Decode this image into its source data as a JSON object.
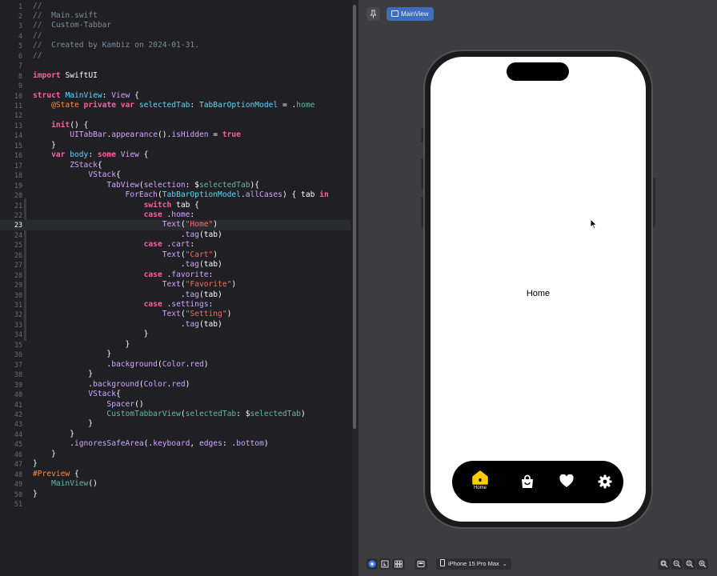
{
  "editor": {
    "current_line": 23,
    "lines": [
      {
        "n": "1",
        "segs": [
          [
            "cm",
            "//"
          ]
        ]
      },
      {
        "n": "2",
        "segs": [
          [
            "cm",
            "//  "
          ],
          [
            "cmt",
            "Main.swift"
          ]
        ]
      },
      {
        "n": "3",
        "segs": [
          [
            "cm",
            "//  "
          ],
          [
            "cmt",
            "Custom-Tabbar"
          ]
        ]
      },
      {
        "n": "4",
        "segs": [
          [
            "cm",
            "//"
          ]
        ]
      },
      {
        "n": "5",
        "segs": [
          [
            "cm",
            "//  "
          ],
          [
            "cmt",
            "Created by Kambiz on 2024-01-31."
          ]
        ]
      },
      {
        "n": "6",
        "segs": [
          [
            "cm",
            "//"
          ]
        ]
      },
      {
        "n": "7",
        "segs": []
      },
      {
        "n": "8",
        "segs": [
          [
            "kw",
            "import "
          ],
          [
            "plain",
            "SwiftUI"
          ]
        ]
      },
      {
        "n": "9",
        "segs": []
      },
      {
        "n": "10",
        "segs": [
          [
            "kw",
            "struct "
          ],
          [
            "ty",
            "MainView"
          ],
          [
            "plain",
            ": "
          ],
          [
            "pj",
            "View"
          ],
          [
            "plain",
            " {"
          ]
        ]
      },
      {
        "n": "11",
        "segs": [
          [
            "plain",
            "    "
          ],
          [
            "at",
            "@State"
          ],
          [
            "plain",
            " "
          ],
          [
            "kw",
            "private var "
          ],
          [
            "ty",
            "selectedTab"
          ],
          [
            "plain",
            ": "
          ],
          [
            "ty",
            "TabBarOptionModel"
          ],
          [
            "plain",
            " = ."
          ],
          [
            "fn",
            "home"
          ]
        ]
      },
      {
        "n": "12",
        "segs": []
      },
      {
        "n": "13",
        "segs": [
          [
            "plain",
            "    "
          ],
          [
            "kw",
            "init"
          ],
          [
            "plain",
            "() {"
          ]
        ]
      },
      {
        "n": "14",
        "segs": [
          [
            "plain",
            "        "
          ],
          [
            "pj",
            "UITabBar"
          ],
          [
            "plain",
            "."
          ],
          [
            "pj",
            "appearance"
          ],
          [
            "plain",
            "()."
          ],
          [
            "pj",
            "isHidden"
          ],
          [
            "plain",
            " = "
          ],
          [
            "kw",
            "true"
          ]
        ]
      },
      {
        "n": "15",
        "segs": [
          [
            "plain",
            "    }"
          ]
        ]
      },
      {
        "n": "16",
        "segs": [
          [
            "plain",
            "    "
          ],
          [
            "kw",
            "var "
          ],
          [
            "ty",
            "body"
          ],
          [
            "plain",
            ": "
          ],
          [
            "kw",
            "some "
          ],
          [
            "pj",
            "View"
          ],
          [
            "plain",
            " {"
          ]
        ]
      },
      {
        "n": "17",
        "segs": [
          [
            "plain",
            "        "
          ],
          [
            "pj",
            "ZStack"
          ],
          [
            "plain",
            "{"
          ]
        ]
      },
      {
        "n": "18",
        "segs": [
          [
            "plain",
            "            "
          ],
          [
            "pj",
            "VStack"
          ],
          [
            "plain",
            "{"
          ]
        ]
      },
      {
        "n": "19",
        "segs": [
          [
            "plain",
            "                "
          ],
          [
            "pj",
            "TabView"
          ],
          [
            "plain",
            "("
          ],
          [
            "pj",
            "selection"
          ],
          [
            "plain",
            ": $"
          ],
          [
            "fn",
            "selectedTab"
          ],
          [
            "plain",
            "){"
          ]
        ]
      },
      {
        "n": "20",
        "segs": [
          [
            "plain",
            "                    "
          ],
          [
            "pj",
            "ForEach"
          ],
          [
            "plain",
            "("
          ],
          [
            "ty",
            "TabBarOptionModel"
          ],
          [
            "plain",
            "."
          ],
          [
            "pj",
            "allCases"
          ],
          [
            "plain",
            ") { tab "
          ],
          [
            "kw",
            "in"
          ]
        ]
      },
      {
        "n": "21",
        "segs": [
          [
            "plain",
            "                        "
          ],
          [
            "kw",
            "switch"
          ],
          [
            "plain",
            " tab {"
          ]
        ]
      },
      {
        "n": "22",
        "segs": [
          [
            "plain",
            "                        "
          ],
          [
            "kw",
            "case"
          ],
          [
            "plain",
            " ."
          ],
          [
            "pj",
            "home"
          ],
          [
            "plain",
            ":"
          ]
        ]
      },
      {
        "n": "23",
        "segs": [
          [
            "plain",
            "                            "
          ],
          [
            "pj",
            "Text"
          ],
          [
            "plain",
            "("
          ],
          [
            "st",
            "\"Home\""
          ],
          [
            "plain",
            ")"
          ]
        ]
      },
      {
        "n": "24",
        "segs": [
          [
            "plain",
            "                                ."
          ],
          [
            "pj",
            "tag"
          ],
          [
            "plain",
            "(tab)"
          ]
        ]
      },
      {
        "n": "25",
        "segs": [
          [
            "plain",
            "                        "
          ],
          [
            "kw",
            "case"
          ],
          [
            "plain",
            " ."
          ],
          [
            "pj",
            "cart"
          ],
          [
            "plain",
            ":"
          ]
        ]
      },
      {
        "n": "26",
        "segs": [
          [
            "plain",
            "                            "
          ],
          [
            "pj",
            "Text"
          ],
          [
            "plain",
            "("
          ],
          [
            "st",
            "\"Cart\""
          ],
          [
            "plain",
            ")"
          ]
        ]
      },
      {
        "n": "27",
        "segs": [
          [
            "plain",
            "                                ."
          ],
          [
            "pj",
            "tag"
          ],
          [
            "plain",
            "(tab)"
          ]
        ]
      },
      {
        "n": "28",
        "segs": [
          [
            "plain",
            "                        "
          ],
          [
            "kw",
            "case"
          ],
          [
            "plain",
            " ."
          ],
          [
            "pj",
            "favorite"
          ],
          [
            "plain",
            ":"
          ]
        ]
      },
      {
        "n": "29",
        "segs": [
          [
            "plain",
            "                            "
          ],
          [
            "pj",
            "Text"
          ],
          [
            "plain",
            "("
          ],
          [
            "st",
            "\"Favorite\""
          ],
          [
            "plain",
            ")"
          ]
        ]
      },
      {
        "n": "30",
        "segs": [
          [
            "plain",
            "                                ."
          ],
          [
            "pj",
            "tag"
          ],
          [
            "plain",
            "(tab)"
          ]
        ]
      },
      {
        "n": "31",
        "segs": [
          [
            "plain",
            "                        "
          ],
          [
            "kw",
            "case"
          ],
          [
            "plain",
            " ."
          ],
          [
            "pj",
            "settings"
          ],
          [
            "plain",
            ":"
          ]
        ]
      },
      {
        "n": "32",
        "segs": [
          [
            "plain",
            "                            "
          ],
          [
            "pj",
            "Text"
          ],
          [
            "plain",
            "("
          ],
          [
            "st",
            "\"Setting\""
          ],
          [
            "plain",
            ")"
          ]
        ]
      },
      {
        "n": "33",
        "segs": [
          [
            "plain",
            "                                ."
          ],
          [
            "pj",
            "tag"
          ],
          [
            "plain",
            "(tab)"
          ]
        ]
      },
      {
        "n": "34",
        "segs": [
          [
            "plain",
            "                        }"
          ]
        ]
      },
      {
        "n": "35",
        "segs": [
          [
            "plain",
            "                    }"
          ]
        ]
      },
      {
        "n": "36",
        "segs": [
          [
            "plain",
            "                }"
          ]
        ]
      },
      {
        "n": "37",
        "segs": [
          [
            "plain",
            "                ."
          ],
          [
            "pj",
            "background"
          ],
          [
            "plain",
            "("
          ],
          [
            "pj",
            "Color"
          ],
          [
            "plain",
            "."
          ],
          [
            "pj",
            "red"
          ],
          [
            "plain",
            ")"
          ]
        ]
      },
      {
        "n": "38",
        "segs": [
          [
            "plain",
            "            }"
          ]
        ]
      },
      {
        "n": "39",
        "segs": [
          [
            "plain",
            "            ."
          ],
          [
            "pj",
            "background"
          ],
          [
            "plain",
            "("
          ],
          [
            "pj",
            "Color"
          ],
          [
            "plain",
            "."
          ],
          [
            "pj",
            "red"
          ],
          [
            "plain",
            ")"
          ]
        ]
      },
      {
        "n": "40",
        "segs": [
          [
            "plain",
            "            "
          ],
          [
            "pj",
            "VStack"
          ],
          [
            "plain",
            "{"
          ]
        ]
      },
      {
        "n": "41",
        "segs": [
          [
            "plain",
            "                "
          ],
          [
            "pj",
            "Spacer"
          ],
          [
            "plain",
            "()"
          ]
        ]
      },
      {
        "n": "42",
        "segs": [
          [
            "plain",
            "                "
          ],
          [
            "fn",
            "CustomTabbarView"
          ],
          [
            "plain",
            "("
          ],
          [
            "fn",
            "selectedTab"
          ],
          [
            "plain",
            ": $"
          ],
          [
            "fn",
            "selectedTab"
          ],
          [
            "plain",
            ")"
          ]
        ]
      },
      {
        "n": "43",
        "segs": [
          [
            "plain",
            "            }"
          ]
        ]
      },
      {
        "n": "44",
        "segs": [
          [
            "plain",
            "        }"
          ]
        ]
      },
      {
        "n": "45",
        "segs": [
          [
            "plain",
            "        ."
          ],
          [
            "pj",
            "ignoresSafeArea"
          ],
          [
            "plain",
            "(."
          ],
          [
            "pj",
            "keyboard"
          ],
          [
            "plain",
            ", "
          ],
          [
            "pj",
            "edges"
          ],
          [
            "plain",
            ": ."
          ],
          [
            "pj",
            "bottom"
          ],
          [
            "plain",
            ")"
          ]
        ]
      },
      {
        "n": "46",
        "segs": [
          [
            "plain",
            "    }"
          ]
        ]
      },
      {
        "n": "47",
        "segs": [
          [
            "plain",
            "}"
          ]
        ]
      },
      {
        "n": "48",
        "segs": [
          [
            "at",
            "#Preview"
          ],
          [
            "plain",
            " {"
          ]
        ]
      },
      {
        "n": "49",
        "segs": [
          [
            "plain",
            "    "
          ],
          [
            "fn",
            "MainView"
          ],
          [
            "plain",
            "()"
          ]
        ]
      },
      {
        "n": "50",
        "segs": [
          [
            "plain",
            "}"
          ]
        ]
      },
      {
        "n": "51",
        "segs": []
      }
    ]
  },
  "preview": {
    "tab_label": "MainView",
    "pin_icon": "pin-icon",
    "screen_text": "Home",
    "tabs": [
      {
        "name": "home",
        "label": "Home",
        "icon": "house-icon",
        "selected": true,
        "color": "#ffcc00"
      },
      {
        "name": "cart",
        "label": "",
        "icon": "bag-icon",
        "selected": false,
        "color": "#ffffff"
      },
      {
        "name": "favorite",
        "label": "",
        "icon": "heart-icon",
        "selected": false,
        "color": "#ffffff"
      },
      {
        "name": "settings",
        "label": "",
        "icon": "gear-icon",
        "selected": false,
        "color": "#ffffff"
      }
    ]
  },
  "bottom_bar": {
    "device": "iPhone 15 Pro Max",
    "live_icon": "live-mode-icon",
    "selectable_icon": "selectable-mode-icon",
    "variants_icon": "variants-icon",
    "settings_icon": "device-settings-icon",
    "zoom_icons": [
      "zoom-to-fit-icon",
      "zoom-out-icon",
      "zoom-100-icon",
      "zoom-in-icon"
    ]
  }
}
